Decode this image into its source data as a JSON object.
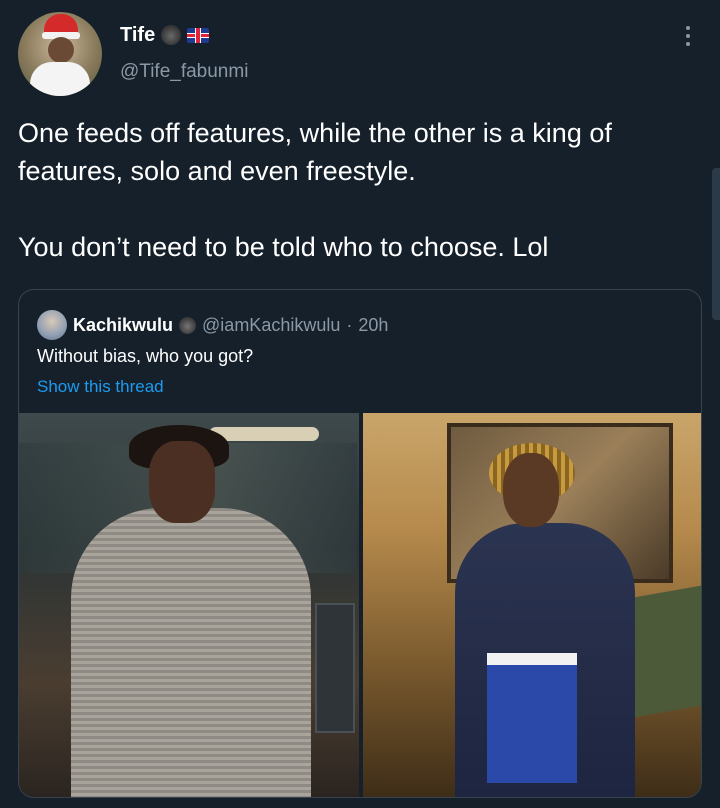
{
  "author": {
    "display_name": "Tife",
    "badges": [
      "gorilla-emoji",
      "uk-flag-emoji"
    ],
    "handle": "@Tife_fabunmi"
  },
  "tweet": {
    "lines": [
      "One feeds off features, while the other is a king of features, solo and even freestyle.",
      "You don’t need to be told who to choose. Lol"
    ]
  },
  "quote": {
    "display_name": "Kachikwulu",
    "badge": "gorilla-emoji",
    "handle": "@iamKachikwulu",
    "separator": "·",
    "time": "20h",
    "text": "Without bias, who you got?",
    "thread_link": "Show this thread",
    "media": [
      "photo-man-in-plaid-suit",
      "photo-man-in-robe-with-phone"
    ]
  },
  "colors": {
    "background": "#15202b",
    "secondary_text": "#8b98a5",
    "link": "#1d9bf0",
    "border": "#38444d"
  }
}
